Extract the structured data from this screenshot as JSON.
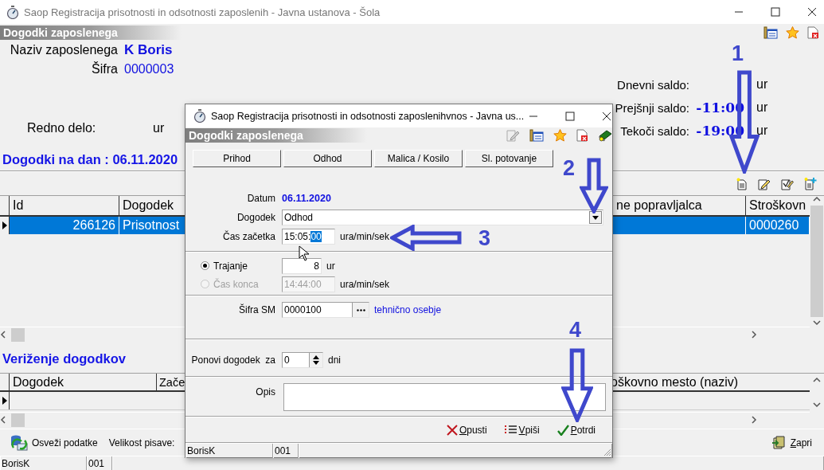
{
  "window": {
    "title": "Saop Registracija prisotnosti in odsotnosti zaposlenih - Javna ustanova - Šola"
  },
  "panel": {
    "title": "Dogodki zaposlenega"
  },
  "employee": {
    "name_label": "Naziv zaposlenega",
    "name": "K Boris",
    "code_label": "Šifra",
    "code": "0000003"
  },
  "work": {
    "label": "Redno delo:",
    "unit": "ur"
  },
  "balances": [
    {
      "label": "Dnevni saldo:",
      "unit": "ur"
    },
    {
      "label": "Prejšnji saldo:",
      "value": "-11:00",
      "unit": "ur"
    },
    {
      "label": "Tekoči saldo:",
      "value": "-19:00",
      "unit": "ur"
    }
  ],
  "events_heading": "Dogodki na dan : 06.11.2020",
  "events_table": {
    "columns": [
      "Id",
      "Dogodek",
      "ne popravljalca",
      "Stroškovn"
    ],
    "rows": [
      {
        "selected": true,
        "id": "266126",
        "dogodek": "Prisotnost",
        "column_4": "0000260"
      }
    ]
  },
  "chain_heading": "Veriženje dogodkov",
  "chain_table": {
    "columns": [
      "Dogodek",
      "Zače",
      "oškovno mesto (naziv)"
    ]
  },
  "footer": {
    "refresh": "Osveži podatke",
    "font_size_label": "Velikost pisave:",
    "close": "Zapri"
  },
  "status_bar": [
    "BorisK",
    "001"
  ],
  "dialog": {
    "title": "Saop Registracija prisotnosti in odsotnosti zaposlenihvnos - Javna us...",
    "panel_title": "Dogodki zaposlenega",
    "quick_buttons": [
      "Prihod",
      "Odhod",
      "Malica / Kosilo",
      "Sl. potovanje"
    ],
    "date_label": "Datum",
    "date": "06.11.2020",
    "event_label": "Dogodek",
    "event": "Odhod",
    "start_label": "Čas začetka",
    "start_value": "15:05:",
    "start_selection": "00",
    "start_unit": "ura/min/sek",
    "duration_modes": [
      {
        "label": "Trajanje",
        "selected": true,
        "disabled": false,
        "value": "8",
        "unit": "ur"
      },
      {
        "label": "Čas konca",
        "selected": false,
        "disabled": true,
        "value": "14:44:00",
        "unit": "ura/min/sek"
      }
    ],
    "sm_label": "Šifra SM",
    "sm_code": "0000100",
    "sm_name": "tehnično osebje",
    "repeat_label": "Ponovi dogodek  za",
    "repeat_value": "0",
    "repeat_unit": "dni",
    "description_label": "Opis",
    "actions": [
      {
        "label": "Opusti",
        "kind": "cancel"
      },
      {
        "label": "Vpiši",
        "kind": "list"
      },
      {
        "label": "Potrdi",
        "kind": "confirm"
      }
    ],
    "status_bar": [
      "BorisK",
      "001"
    ]
  },
  "annotations": [
    {
      "number": "1",
      "kind": "down"
    },
    {
      "number": "2",
      "kind": "down"
    },
    {
      "number": "3",
      "kind": "left"
    },
    {
      "number": "4",
      "kind": "down"
    }
  ]
}
